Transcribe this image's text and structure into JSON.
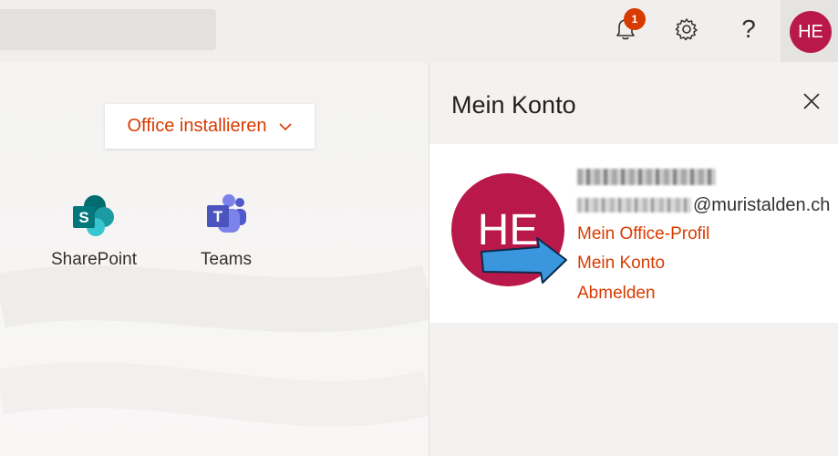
{
  "header": {
    "notification_count": "1",
    "help_glyph": "?",
    "avatar_initials": "HE",
    "bell_icon": "bell-icon",
    "gear_icon": "gear-icon"
  },
  "main": {
    "install_label": "Office installieren",
    "apps": [
      {
        "label": "SharePoint",
        "icon": "sharepoint-icon"
      },
      {
        "label": "Teams",
        "icon": "teams-icon"
      }
    ]
  },
  "account_panel": {
    "title": "Mein Konto",
    "avatar_initials": "HE",
    "email_domain": "@muristalden.ch",
    "links": {
      "profile": "Mein Office-Profil",
      "account": "Mein Konto",
      "signout": "Abmelden"
    }
  },
  "colors": {
    "accent": "#d83b01",
    "avatar": "#b9194a",
    "arrow": "#3a96dd"
  }
}
